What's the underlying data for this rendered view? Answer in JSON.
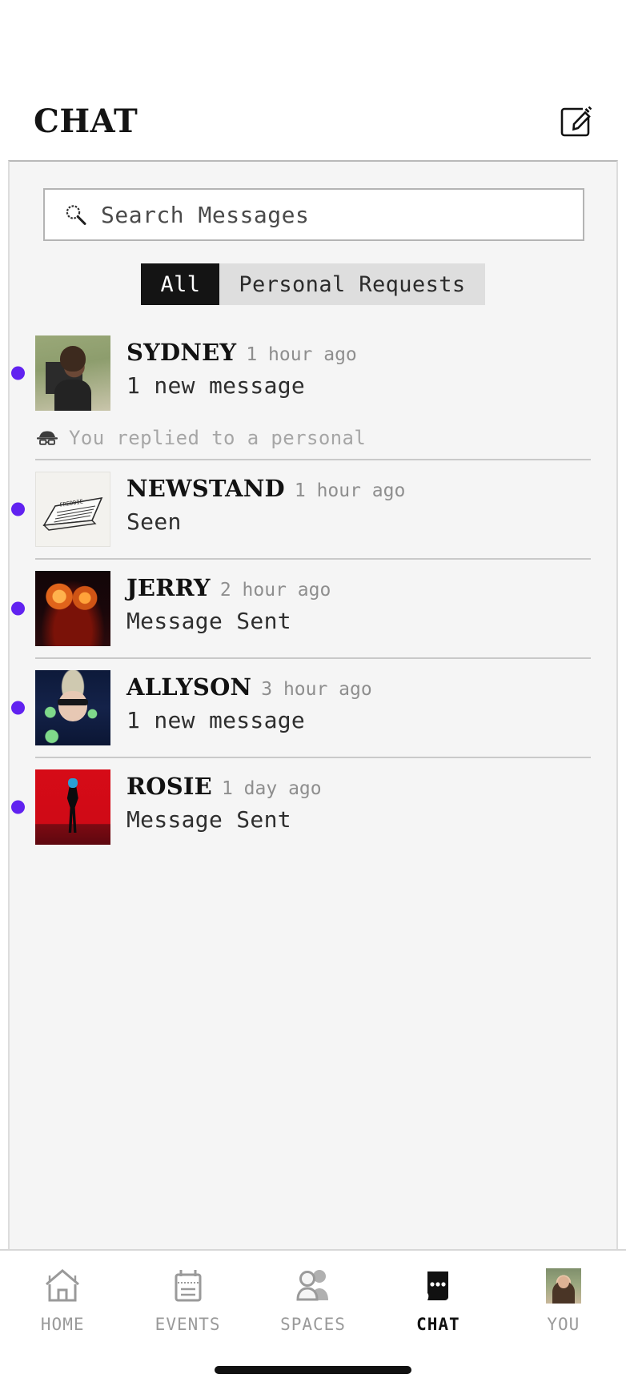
{
  "header": {
    "title": "CHAT",
    "compose_icon": "compose-pencil-square-icon"
  },
  "search": {
    "placeholder": "Search Messages",
    "value": "",
    "icon": "search-magnifier-icon"
  },
  "filters": {
    "options": [
      "All",
      "Personal Requests"
    ],
    "selected": "All",
    "active_bg": "#141414",
    "track_bg": "#dedede"
  },
  "colors": {
    "unread_dot": "#6122f0",
    "panel_bg": "#f5f5f5",
    "page_bg": "#ffffff",
    "divider": "#c9c9c9",
    "muted_text": "#8e8e8e",
    "sub_text": "#a6a6a6"
  },
  "conversations": [
    {
      "name": "SYDNEY",
      "time": "1 hour ago",
      "preview": "1 new message",
      "unread": true,
      "avatar": "sydney-portrait-avatar",
      "sub_note": "You replied to a personal",
      "sub_icon": "incognito-icon"
    },
    {
      "name": "NEWSTAND",
      "time": "1 hour ago",
      "preview": "Seen",
      "unread": true,
      "avatar": "newspaper-sketch-avatar"
    },
    {
      "name": "JERRY",
      "time": "2 hour ago",
      "preview": "Message Sent",
      "unread": true,
      "avatar": "jack-o-lanterns-avatar"
    },
    {
      "name": "ALLYSON",
      "time": "3 hour ago",
      "preview": "1 new message",
      "unread": true,
      "avatar": "allyson-portrait-avatar"
    },
    {
      "name": "ROSIE",
      "time": "1 day ago",
      "preview": "Message Sent",
      "unread": true,
      "avatar": "rosie-red-silhouette-avatar"
    }
  ],
  "tabbar": {
    "items": [
      {
        "label": "HOME",
        "icon": "house-icon",
        "active": false
      },
      {
        "label": "EVENTS",
        "icon": "calendar-icon",
        "active": false
      },
      {
        "label": "SPACES",
        "icon": "people-group-icon",
        "active": false
      },
      {
        "label": "CHAT",
        "icon": "chat-bubble-icon",
        "active": true
      },
      {
        "label": "YOU",
        "icon": "profile-avatar",
        "active": false
      }
    ]
  }
}
